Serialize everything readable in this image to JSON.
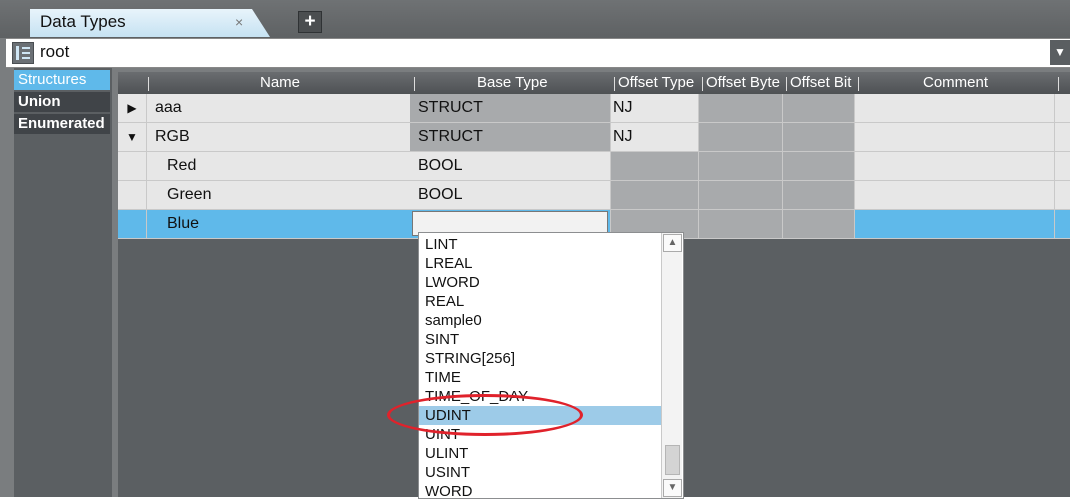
{
  "tab": {
    "title": "Data Types",
    "close": "×",
    "add": "+"
  },
  "namespace": {
    "label": "root",
    "dropdown": "▼"
  },
  "left_tabs": [
    "Structures",
    "Union",
    "Enumerated"
  ],
  "columns": {
    "name": "Name",
    "base_type": "Base Type",
    "offset_type": "Offset Type",
    "offset_byte": "Offset Byte",
    "offset_bit": "Offset Bit",
    "comment": "Comment"
  },
  "rows": [
    {
      "expander": "▶",
      "name": "aaa",
      "base_type": "STRUCT",
      "offset_type": "NJ"
    },
    {
      "expander": "▼",
      "name": "RGB",
      "base_type": "STRUCT",
      "offset_type": "NJ"
    },
    {
      "expander": "",
      "name": "Red",
      "base_type": "BOOL",
      "offset_type": ""
    },
    {
      "expander": "",
      "name": "Green",
      "base_type": "BOOL",
      "offset_type": ""
    },
    {
      "expander": "",
      "name": "Blue",
      "base_type": "",
      "offset_type": ""
    }
  ],
  "dropdown_options": [
    "LINT",
    "LREAL",
    "LWORD",
    "REAL",
    "sample0",
    "SINT",
    "STRING[256]",
    "TIME",
    "TIME_OF_DAY",
    "UDINT",
    "UINT",
    "ULINT",
    "USINT",
    "WORD"
  ],
  "highlighted_option": "UDINT",
  "scroll": {
    "up": "▲",
    "down": "▼"
  },
  "colors": {
    "selection": "#5fb9ea",
    "highlight": "#9dcbe8",
    "annotation": "#e0222b"
  }
}
